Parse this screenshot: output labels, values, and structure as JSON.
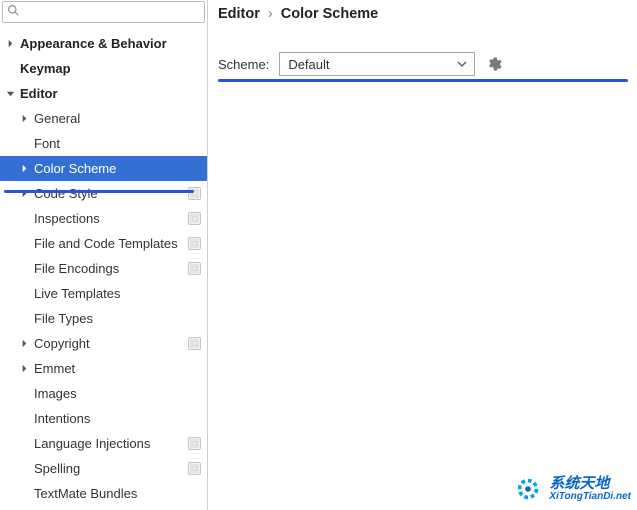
{
  "search": {
    "placeholder": ""
  },
  "sidebar": {
    "items": [
      {
        "label": "Appearance & Behavior",
        "depth": 0,
        "arrow": "right",
        "bold": true
      },
      {
        "label": "Keymap",
        "depth": 0,
        "arrow": "none",
        "bold": true
      },
      {
        "label": "Editor",
        "depth": 0,
        "arrow": "down",
        "bold": true
      },
      {
        "label": "General",
        "depth": 1,
        "arrow": "right"
      },
      {
        "label": "Font",
        "depth": 1,
        "arrow": "none"
      },
      {
        "label": "Color Scheme",
        "depth": 1,
        "arrow": "right",
        "selected": true
      },
      {
        "label": "Code Style",
        "depth": 1,
        "arrow": "right",
        "badge": true
      },
      {
        "label": "Inspections",
        "depth": 1,
        "arrow": "none",
        "badge": true
      },
      {
        "label": "File and Code Templates",
        "depth": 1,
        "arrow": "none",
        "badge": true
      },
      {
        "label": "File Encodings",
        "depth": 1,
        "arrow": "none",
        "badge": true
      },
      {
        "label": "Live Templates",
        "depth": 1,
        "arrow": "none"
      },
      {
        "label": "File Types",
        "depth": 1,
        "arrow": "none"
      },
      {
        "label": "Copyright",
        "depth": 1,
        "arrow": "right",
        "badge": true
      },
      {
        "label": "Emmet",
        "depth": 1,
        "arrow": "right"
      },
      {
        "label": "Images",
        "depth": 1,
        "arrow": "none"
      },
      {
        "label": "Intentions",
        "depth": 1,
        "arrow": "none"
      },
      {
        "label": "Language Injections",
        "depth": 1,
        "arrow": "none",
        "badge": true
      },
      {
        "label": "Spelling",
        "depth": 1,
        "arrow": "none",
        "badge": true
      },
      {
        "label": "TextMate Bundles",
        "depth": 1,
        "arrow": "none"
      }
    ]
  },
  "breadcrumb": {
    "parent": "Editor",
    "sep": "›",
    "current": "Color Scheme"
  },
  "scheme": {
    "label": "Scheme:",
    "value": "Default"
  },
  "watermark": {
    "title": "系统天地",
    "url": "XiTongTianDi.net"
  },
  "colors": {
    "selection": "#3470d4",
    "annotation": "#2854d6"
  }
}
